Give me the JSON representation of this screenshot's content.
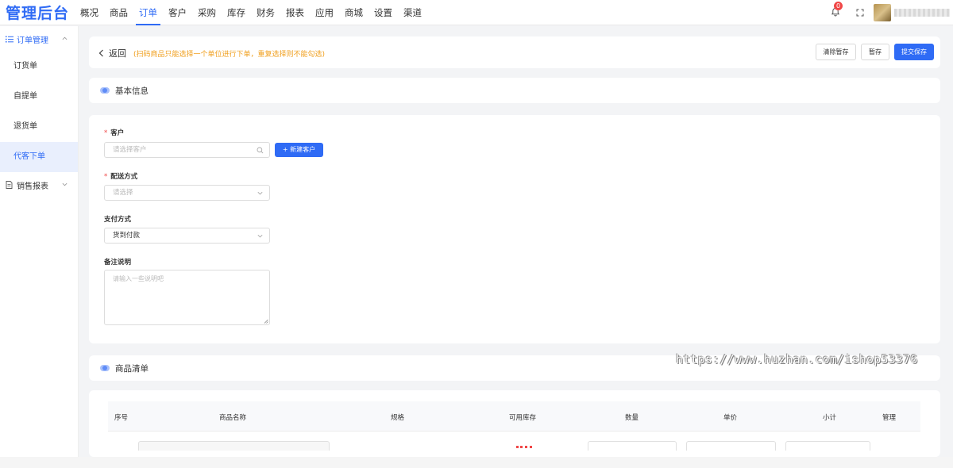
{
  "brand": {
    "logo": "管理后台",
    "accent": "#2f6bf5"
  },
  "nav": {
    "items": [
      "概况",
      "商品",
      "订单",
      "客户",
      "采购",
      "库存",
      "财务",
      "报表",
      "应用",
      "商城",
      "设置",
      "渠道"
    ],
    "active_index": 2
  },
  "topbar": {
    "notification_count": "0"
  },
  "sidebar": {
    "group_order": "订单管理",
    "items": [
      "订货单",
      "自提单",
      "退货单",
      "代客下单"
    ],
    "active_item": "代客下单",
    "group_report": "销售报表"
  },
  "header": {
    "back_label": "返回",
    "note": "(扫码商品只能选择一个单位进行下单，重复选择则不能勾选)",
    "clear_draft": "清除暂存",
    "save_draft": "暂存",
    "submit": "提交保存"
  },
  "basic_info": {
    "title": "基本信息",
    "customer_label": "客户",
    "customer_placeholder": "请选择客户",
    "new_customer": "+ 新建客户",
    "delivery_label": "配送方式",
    "delivery_placeholder": "请选择",
    "payment_label": "支付方式",
    "payment_value": "货到付款",
    "remark_label": "备注说明",
    "remark_placeholder": "请输入一些说明吧"
  },
  "goods": {
    "title": "商品清单",
    "columns": [
      "序号",
      "商品名称",
      "规格",
      "可用库存",
      "数量",
      "单价",
      "小计",
      "管理"
    ]
  },
  "watermark": "https://www.huzhan.com/ishop53376"
}
